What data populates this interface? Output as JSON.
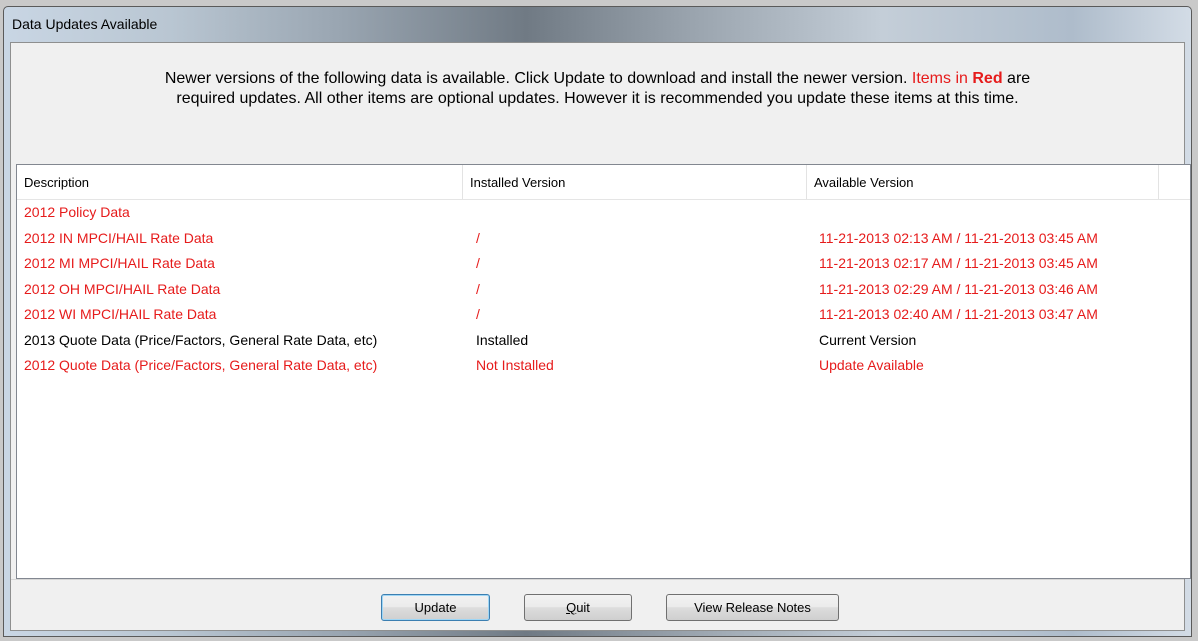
{
  "window": {
    "title": "Data Updates Available"
  },
  "message": {
    "part1": "Newer versions of the following data is available. Click Update to download and install the newer version. ",
    "items_in": "Items in ",
    "red_word": "Red",
    "are": " are",
    "part2": "required updates. All other items are optional updates. However it is recommended you update these items at this time."
  },
  "list": {
    "columns": [
      "Description",
      "Installed Version",
      "Available Version"
    ],
    "rows": [
      {
        "description": "2012 Policy Data",
        "installed": "",
        "available": "",
        "required": true
      },
      {
        "description": "2012 IN MPCI/HAIL Rate Data",
        "installed": "/",
        "available": "11-21-2013 02:13 AM / 11-21-2013 03:45 AM",
        "required": true
      },
      {
        "description": "2012 MI MPCI/HAIL Rate Data",
        "installed": "/",
        "available": "11-21-2013 02:17 AM / 11-21-2013 03:45 AM",
        "required": true
      },
      {
        "description": "2012 OH MPCI/HAIL Rate Data",
        "installed": "/",
        "available": "11-21-2013 02:29 AM / 11-21-2013 03:46 AM",
        "required": true
      },
      {
        "description": "2012 WI MPCI/HAIL Rate Data",
        "installed": "/",
        "available": "11-21-2013 02:40 AM / 11-21-2013 03:47 AM",
        "required": true
      },
      {
        "description": "2013 Quote Data (Price/Factors, General Rate Data, etc)",
        "installed": "Installed",
        "available": "Current Version",
        "required": false
      },
      {
        "description": "2012 Quote Data (Price/Factors, General Rate Data, etc)",
        "installed": "Not Installed",
        "available": "Update Available",
        "required": true
      }
    ]
  },
  "buttons": {
    "update": "Update",
    "quit_mnemonic": "Q",
    "quit_rest": "uit",
    "release_notes": "View Release Notes"
  },
  "colors": {
    "required_text": "#e61b1b",
    "optional_text": "#000000"
  }
}
